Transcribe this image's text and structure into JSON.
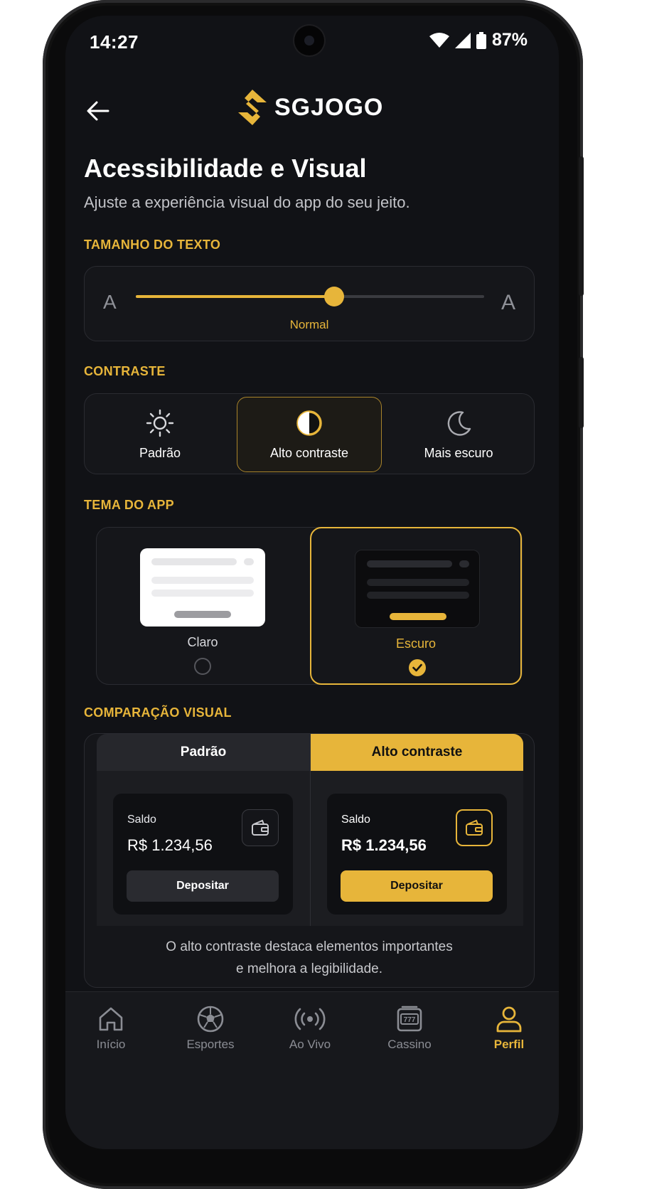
{
  "status_bar": {
    "time": "14:27",
    "battery_percent": "87%"
  },
  "header": {
    "brand": "SGJOGO"
  },
  "page": {
    "title": "Acessibilidade e Visual",
    "subtitle": "Ajuste a experiência visual do app do seu jeito."
  },
  "text_size": {
    "section_label": "TAMANHO DO TEXTO",
    "small_glyph": "A",
    "large_glyph": "A",
    "value_label": "Normal",
    "level": 0.57
  },
  "contrast": {
    "section_label": "CONTRASTE",
    "options": [
      {
        "label": "Padrão",
        "icon": "sun-icon",
        "selected": false
      },
      {
        "label": "Alto contraste",
        "icon": "half-circle-icon",
        "selected": true
      },
      {
        "label": "Mais escuro",
        "icon": "moon-icon",
        "selected": false
      }
    ]
  },
  "theme": {
    "section_label": "TEMA DO APP",
    "options": [
      {
        "label": "Claro",
        "selected": false
      },
      {
        "label": "Escuro",
        "selected": true
      }
    ]
  },
  "comparison": {
    "section_label": "COMPARAÇÃO VISUAL",
    "panels": [
      {
        "tab": "Padrão",
        "balance_label": "Saldo",
        "amount": "R$ 1.234,56",
        "button": "Depositar"
      },
      {
        "tab": "Alto contraste",
        "balance_label": "Saldo",
        "amount": "R$ 1.234,56",
        "button": "Depositar"
      }
    ],
    "note_line1": "O alto contraste destaca elementos importantes",
    "note_line2": "e melhora a legibilidade."
  },
  "bottom_nav": {
    "items": [
      {
        "label": "Início",
        "icon": "home-icon",
        "active": false
      },
      {
        "label": "Esportes",
        "icon": "soccer-ball-icon",
        "active": false
      },
      {
        "label": "Ao Vivo",
        "icon": "live-broadcast-icon",
        "active": false
      },
      {
        "label": "Cassino",
        "icon": "slot-machine-icon",
        "active": false
      },
      {
        "label": "Perfil",
        "icon": "user-icon",
        "active": true
      }
    ]
  },
  "colors": {
    "accent": "#e7b53a",
    "background": "#111216",
    "card": "#15161a"
  }
}
